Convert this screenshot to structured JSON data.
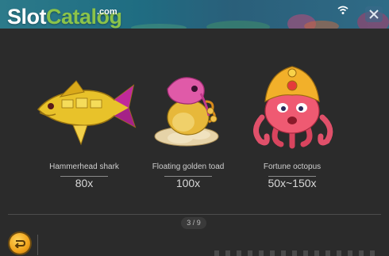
{
  "header": {
    "logo_slot": "Slot",
    "logo_catalog": "Catalog",
    "logo_com": ".com",
    "wifi_icon": "wifi-icon",
    "close_icon": "close-icon"
  },
  "symbols": [
    {
      "name": "Hammerhead shark",
      "multiplier": "80x",
      "icon": "golden-shark-icon"
    },
    {
      "name": "Floating golden toad",
      "multiplier": "100x",
      "icon": "golden-toad-icon"
    },
    {
      "name": "Fortune octopus",
      "multiplier": "50x~150x",
      "icon": "fortune-octopus-icon"
    }
  ],
  "pager": {
    "label": "3 / 9"
  },
  "footer": {
    "back_icon": "back-arrow-icon"
  },
  "colors": {
    "background": "#2b2b2b",
    "logo_green": "#8bc34a",
    "button_gold": "#f0a21a"
  }
}
